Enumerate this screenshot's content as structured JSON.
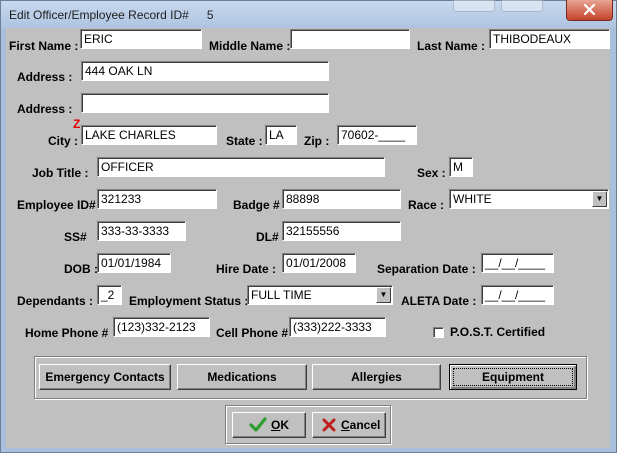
{
  "window": {
    "title": "Edit Officer/Employee Record ID#",
    "record_id": "5"
  },
  "labels": {
    "first_name": "First Name :",
    "middle_name": "Middle Name :",
    "last_name": "Last Name :",
    "address1": "Address :",
    "address2": "Address :",
    "city": "City :",
    "state": "State :",
    "zip": "Zip :",
    "job_title": "Job Title :",
    "sex": "Sex :",
    "employee_id": "Employee ID#",
    "badge": "Badge #",
    "race": "Race :",
    "ssn": "SS#",
    "dl": "DL#",
    "dob": "DOB :",
    "hire_date": "Hire Date :",
    "separation_date": "Separation Date :",
    "dependants": "Dependants :",
    "employment_status": "Employment Status :",
    "aleta_date": "ALETA Date :",
    "home_phone": "Home Phone #",
    "cell_phone": "Cell Phone #",
    "post_certified": "P.O.S.T. Certified",
    "city_required_marker": "Z"
  },
  "fields": {
    "first_name": "ERIC",
    "middle_name": "",
    "last_name": "THIBODEAUX",
    "address1": "444 OAK LN",
    "address2": "",
    "city": "LAKE CHARLES",
    "state": "LA",
    "zip": "70602-____",
    "job_title": "OFFICER",
    "sex": "M",
    "employee_id": "321233",
    "badge": "88898",
    "race": "WHITE",
    "ssn": "333-33-3333",
    "dl": "32155556",
    "dob": "01/01/1984",
    "hire_date": "01/01/2008",
    "separation_date": "__/__/____",
    "dependants": "_2",
    "employment_status": "FULL TIME",
    "aleta_date": "__/__/____",
    "home_phone": "(123)332-2123",
    "cell_phone": "(333)222-3333",
    "post_certified": false
  },
  "buttons": {
    "emergency_contacts": "Emergency Contacts",
    "medications": "Medications",
    "allergies": "Allergies",
    "equipment": "Equipment",
    "ok_hotkey": "O",
    "ok_rest": "K",
    "cancel_hotkey": "C",
    "cancel_rest": "ancel"
  },
  "icons": {
    "ok": "green-checkmark-icon",
    "cancel": "red-x-icon"
  },
  "colors": {
    "dialog_face": "#c0c0c0",
    "titlebar": "#aec4e1",
    "close_button": "#c6432c",
    "required_marker": "#e00000",
    "ok_check": "#2e9e2e",
    "cancel_x": "#c0201c"
  }
}
